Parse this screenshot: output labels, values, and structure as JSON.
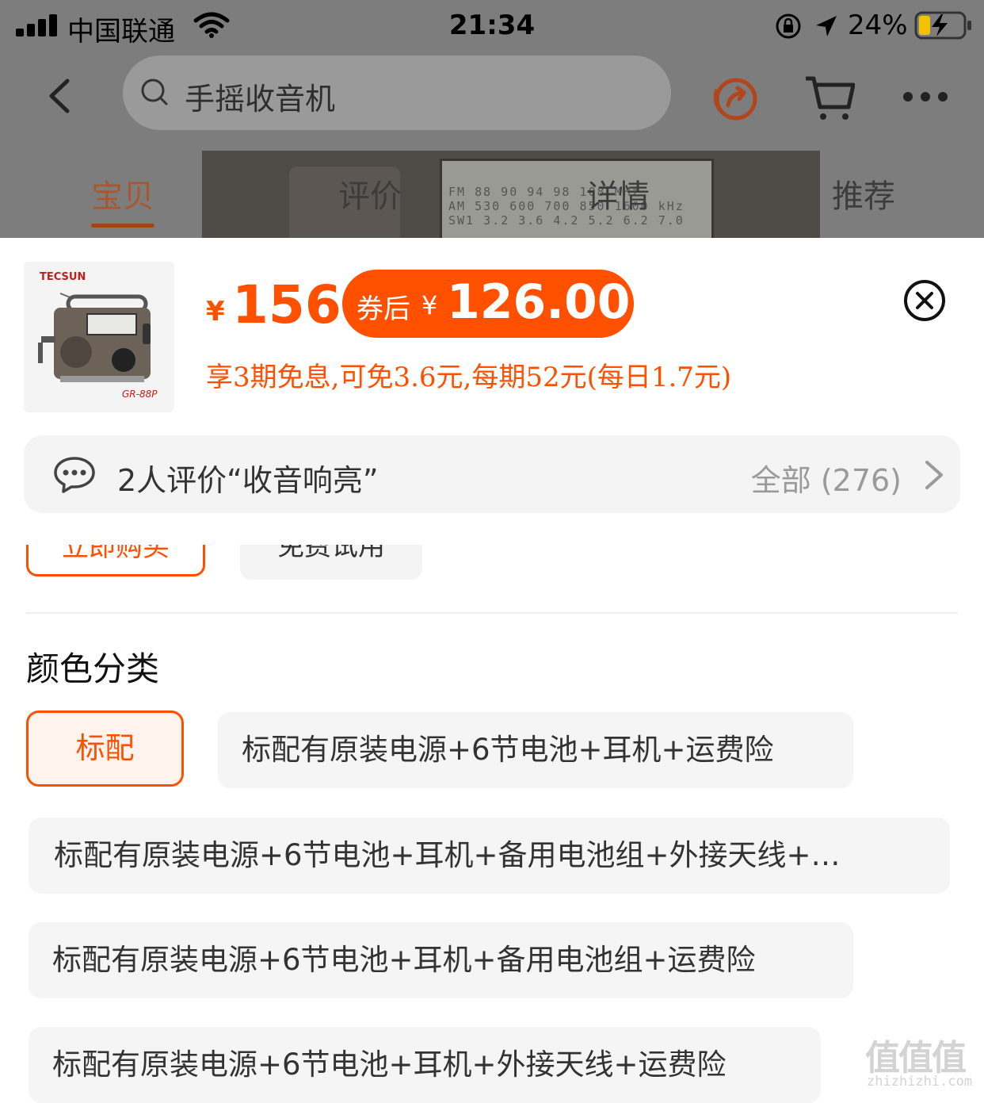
{
  "status_bar": {
    "carrier": "中国联通",
    "time": "21:34",
    "battery_pct": "24%"
  },
  "header": {
    "search_text": "手摇收音机"
  },
  "tabs": [
    {
      "label": "宝贝",
      "active": true
    },
    {
      "label": "评价",
      "active": false
    },
    {
      "label": "详情",
      "active": false
    },
    {
      "label": "推荐",
      "active": false
    }
  ],
  "hero_scale": {
    "line1": "FM 88 90 94 98 108 MHz",
    "line2": "AM 530 600 700 850 1600 kHz",
    "line3": "SW1 3.2 3.6 4.2 5.2 6.2 7.0"
  },
  "product": {
    "thumb_brand": "TECSUN",
    "thumb_model": "GR-88P",
    "price_symbol": "¥",
    "price": "156",
    "coupon_label": "券后",
    "coupon_symbol": "¥",
    "coupon_price": "126.00",
    "installment": "享3期免息,可免3.6元,每期52元(每日1.7元)"
  },
  "review": {
    "text": "2人评价“收音响亮”",
    "all_label": "全部 (276)"
  },
  "actions": {
    "buy_now": "立即购买",
    "free_trial": "免费试用"
  },
  "color_section": {
    "title": "颜色分类",
    "options": [
      {
        "label": "标配",
        "selected": true
      },
      {
        "label": "标配有原装电源+6节电池+耳机+运费险",
        "selected": false
      },
      {
        "label": "标配有原装电源+6节电池+耳机+备用电池组+外接天线+…",
        "selected": false
      },
      {
        "label": "标配有原装电源+6节电池+耳机+备用电池组+运费险",
        "selected": false
      },
      {
        "label": "标配有原装电源+6节电池+耳机+外接天线+运费险",
        "selected": false
      }
    ]
  },
  "watermark": {
    "mark": "值值值",
    "site": "zhizhizhi.com"
  },
  "colors": {
    "accent": "#ff5000",
    "overlay": "#7d7d7d",
    "chip_bg": "#f5f5f5"
  }
}
